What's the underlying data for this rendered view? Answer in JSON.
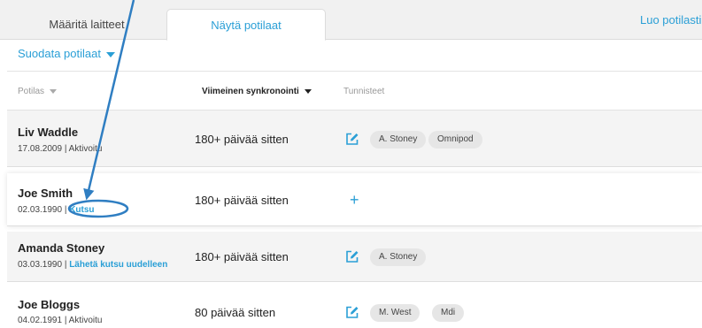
{
  "tabs": {
    "devices": "Määritä laitteet",
    "patients": "Näytä potilaat"
  },
  "create_link": "Luo potilastili",
  "filter": {
    "label": "Suodata potilaat"
  },
  "columns": {
    "patient": "Potilas",
    "sync": "Viimeinen synkronointi",
    "tags": "Tunnisteet"
  },
  "rows": [
    {
      "name": "Liv Waddle",
      "date": "17.08.2009 | ",
      "status": "Aktivoitu",
      "status_is_link": false,
      "sync": "180+ päivää sitten",
      "tags": [
        "A. Stoney",
        "Omnipod"
      ]
    },
    {
      "name": "Joe Smith",
      "date": "02.03.1990 | ",
      "status": "Kutsu",
      "status_is_link": true,
      "sync": "180+ päivää sitten",
      "tags": []
    },
    {
      "name": "Amanda Stoney",
      "date": "03.03.1990 | ",
      "status": "Lähetä kutsu uudelleen",
      "status_is_link": true,
      "sync": "180+ päivää sitten",
      "tags": [
        "A. Stoney"
      ]
    },
    {
      "name": "Joe Bloggs",
      "date": "04.02.1991 | ",
      "status": "Aktivoitu",
      "status_is_link": false,
      "sync": "80 päivää sitten",
      "tags": [
        "M. West",
        "Mdi"
      ]
    }
  ],
  "colors": {
    "accent": "#2a9fd6",
    "annotation": "#2f7ec2",
    "row_shaded": "#f4f4f4",
    "tag_bg": "#e6e6e6"
  },
  "icons": {
    "filter_caret": "chevron-down-icon",
    "sort_caret": "chevron-down-icon",
    "edit_tags": "edit-icon",
    "add_tag": "plus-icon"
  }
}
